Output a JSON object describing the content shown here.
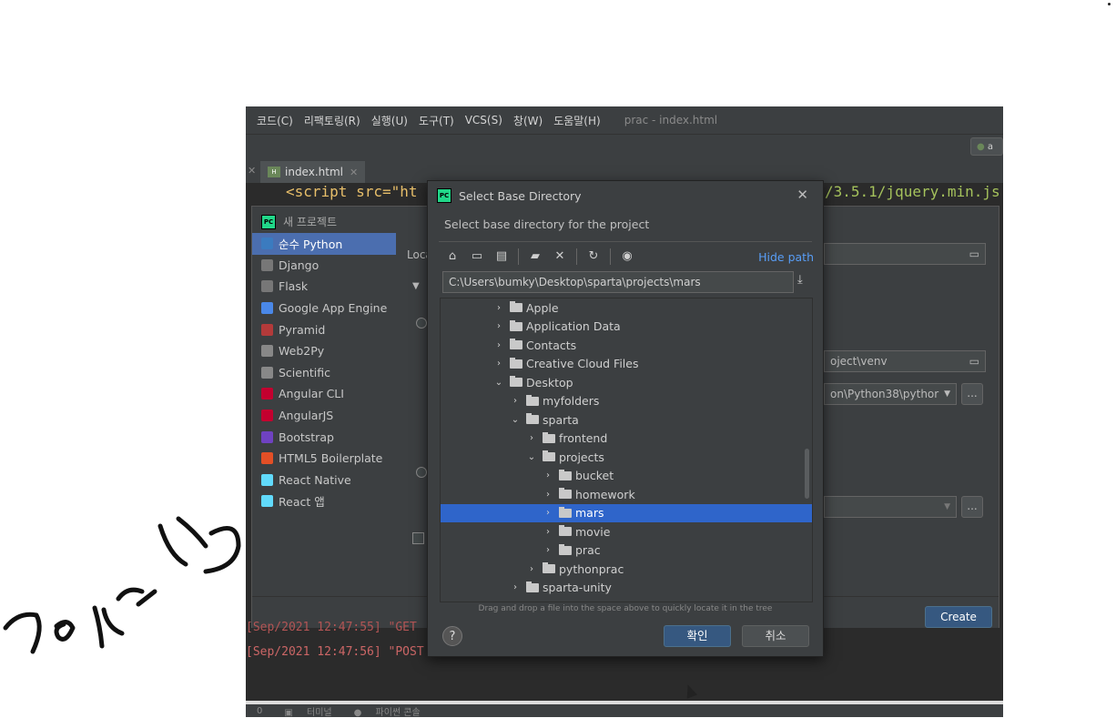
{
  "ide": {
    "menu": [
      "코드(C)",
      "리팩토링(R)",
      "실행(U)",
      "도구(T)",
      "VCS(S)",
      "창(W)",
      "도움말(H)"
    ],
    "title": "prac - index.html",
    "run_label": "a",
    "tab": {
      "name": "index.html",
      "icon": "html-file-icon"
    },
    "code": {
      "left": "<script src=\"ht",
      "right": "/3.5.1/jquery.min.js"
    }
  },
  "new_project": {
    "title": "새 프로젝트",
    "items": [
      {
        "label": "순수 Python",
        "selected": true,
        "icon": "python-icon",
        "color": "#3b7bbf"
      },
      {
        "label": "Django",
        "selected": false,
        "icon": "django-icon",
        "color": "#777777"
      },
      {
        "label": "Flask",
        "selected": false,
        "icon": "flask-icon",
        "color": "#777777"
      },
      {
        "label": "Google App Engine",
        "selected": false,
        "icon": "google-app-engine-icon",
        "color": "#4a88e8"
      },
      {
        "label": "Pyramid",
        "selected": false,
        "icon": "pyramid-icon",
        "color": "#b33a3a"
      },
      {
        "label": "Web2Py",
        "selected": false,
        "icon": "web2py-icon",
        "color": "#888888"
      },
      {
        "label": "Scientific",
        "selected": false,
        "icon": "scientific-icon",
        "color": "#888888"
      },
      {
        "label": "Angular CLI",
        "selected": false,
        "icon": "angular-icon",
        "color": "#c3002f"
      },
      {
        "label": "AngularJS",
        "selected": false,
        "icon": "angularjs-icon",
        "color": "#c3002f"
      },
      {
        "label": "Bootstrap",
        "selected": false,
        "icon": "bootstrap-icon",
        "color": "#6f42c1"
      },
      {
        "label": "HTML5 Boilerplate",
        "selected": false,
        "icon": "html5-icon",
        "color": "#e34f26"
      },
      {
        "label": "React Native",
        "selected": false,
        "icon": "react-icon",
        "color": "#61dafb"
      },
      {
        "label": "React 앱",
        "selected": false,
        "icon": "react-icon",
        "color": "#61dafb"
      }
    ],
    "location_label": "Loca",
    "venv_path": "oject\\venv",
    "interpreter": "on\\Python38\\pythor",
    "ellipsis": "...",
    "create_label": "Create"
  },
  "dialog": {
    "title": "Select Base Directory",
    "subtitle": "Select base directory for the project",
    "hide_path": "Hide path",
    "path": "C:\\Users\\bumky\\Desktop\\sparta\\projects\\mars",
    "tree": [
      {
        "label": "Apple",
        "depth": 0,
        "expanded": false,
        "selected": false
      },
      {
        "label": "Application Data",
        "depth": 0,
        "expanded": false,
        "selected": false
      },
      {
        "label": "Contacts",
        "depth": 0,
        "expanded": false,
        "selected": false
      },
      {
        "label": "Creative Cloud Files",
        "depth": 0,
        "expanded": false,
        "selected": false
      },
      {
        "label": "Desktop",
        "depth": 0,
        "expanded": true,
        "selected": false
      },
      {
        "label": "myfolders",
        "depth": 1,
        "expanded": false,
        "selected": false
      },
      {
        "label": "sparta",
        "depth": 1,
        "expanded": true,
        "selected": false
      },
      {
        "label": "frontend",
        "depth": 2,
        "expanded": false,
        "selected": false
      },
      {
        "label": "projects",
        "depth": 2,
        "expanded": true,
        "selected": false
      },
      {
        "label": "bucket",
        "depth": 3,
        "expanded": false,
        "selected": false
      },
      {
        "label": "homework",
        "depth": 3,
        "expanded": false,
        "selected": false
      },
      {
        "label": "mars",
        "depth": 3,
        "expanded": false,
        "selected": true
      },
      {
        "label": "movie",
        "depth": 3,
        "expanded": false,
        "selected": false
      },
      {
        "label": "prac",
        "depth": 3,
        "expanded": false,
        "selected": false
      },
      {
        "label": "pythonprac",
        "depth": 2,
        "expanded": false,
        "selected": false
      },
      {
        "label": "sparta-unity",
        "depth": 1,
        "expanded": false,
        "selected": false
      }
    ],
    "hint": "Drag and drop a file into the space above to quickly locate it in the tree",
    "help_label": "?",
    "ok_label": "확인",
    "cancel_label": "취소"
  },
  "console": {
    "line1": "[Sep/2021 12:47:55] \"GET",
    "line2": "[Sep/2021 12:47:56] \"POST"
  },
  "statusbar": [
    "0",
    "터미널",
    "파이썬 콘솔"
  ]
}
